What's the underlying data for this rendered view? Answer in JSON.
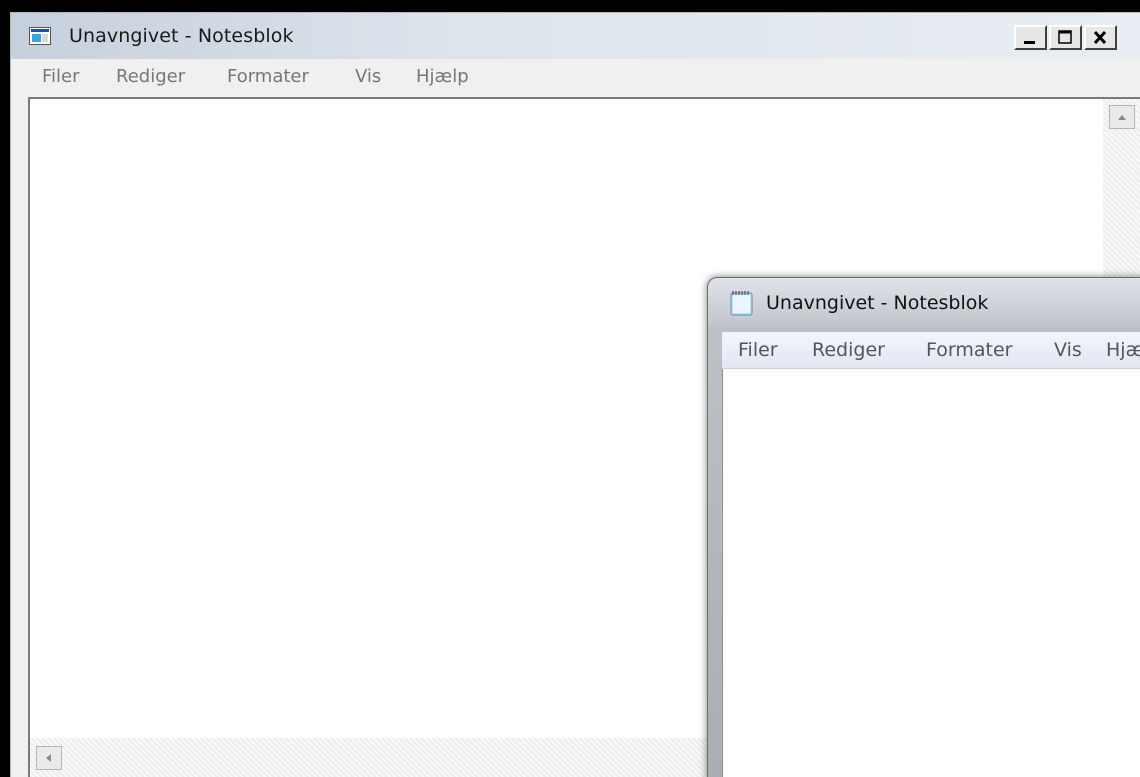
{
  "back_window": {
    "title": "Unavngivet - Notesblok",
    "menu": [
      "Filer",
      "Rediger",
      "Formater",
      "Vis",
      "Hjælp"
    ],
    "controls": [
      "minimize",
      "maximize",
      "close"
    ],
    "text_content": ""
  },
  "front_window": {
    "title": "Unavngivet - Notesblok",
    "menu": [
      "Filer",
      "Rediger",
      "Formater",
      "Vis",
      "Hjælp"
    ],
    "text_content": ""
  },
  "icons": {
    "back_app": "notepad-classic-icon",
    "front_app": "notepad-aero-icon",
    "scroll_up": "arrow-up-icon",
    "scroll_left": "arrow-left-icon"
  }
}
